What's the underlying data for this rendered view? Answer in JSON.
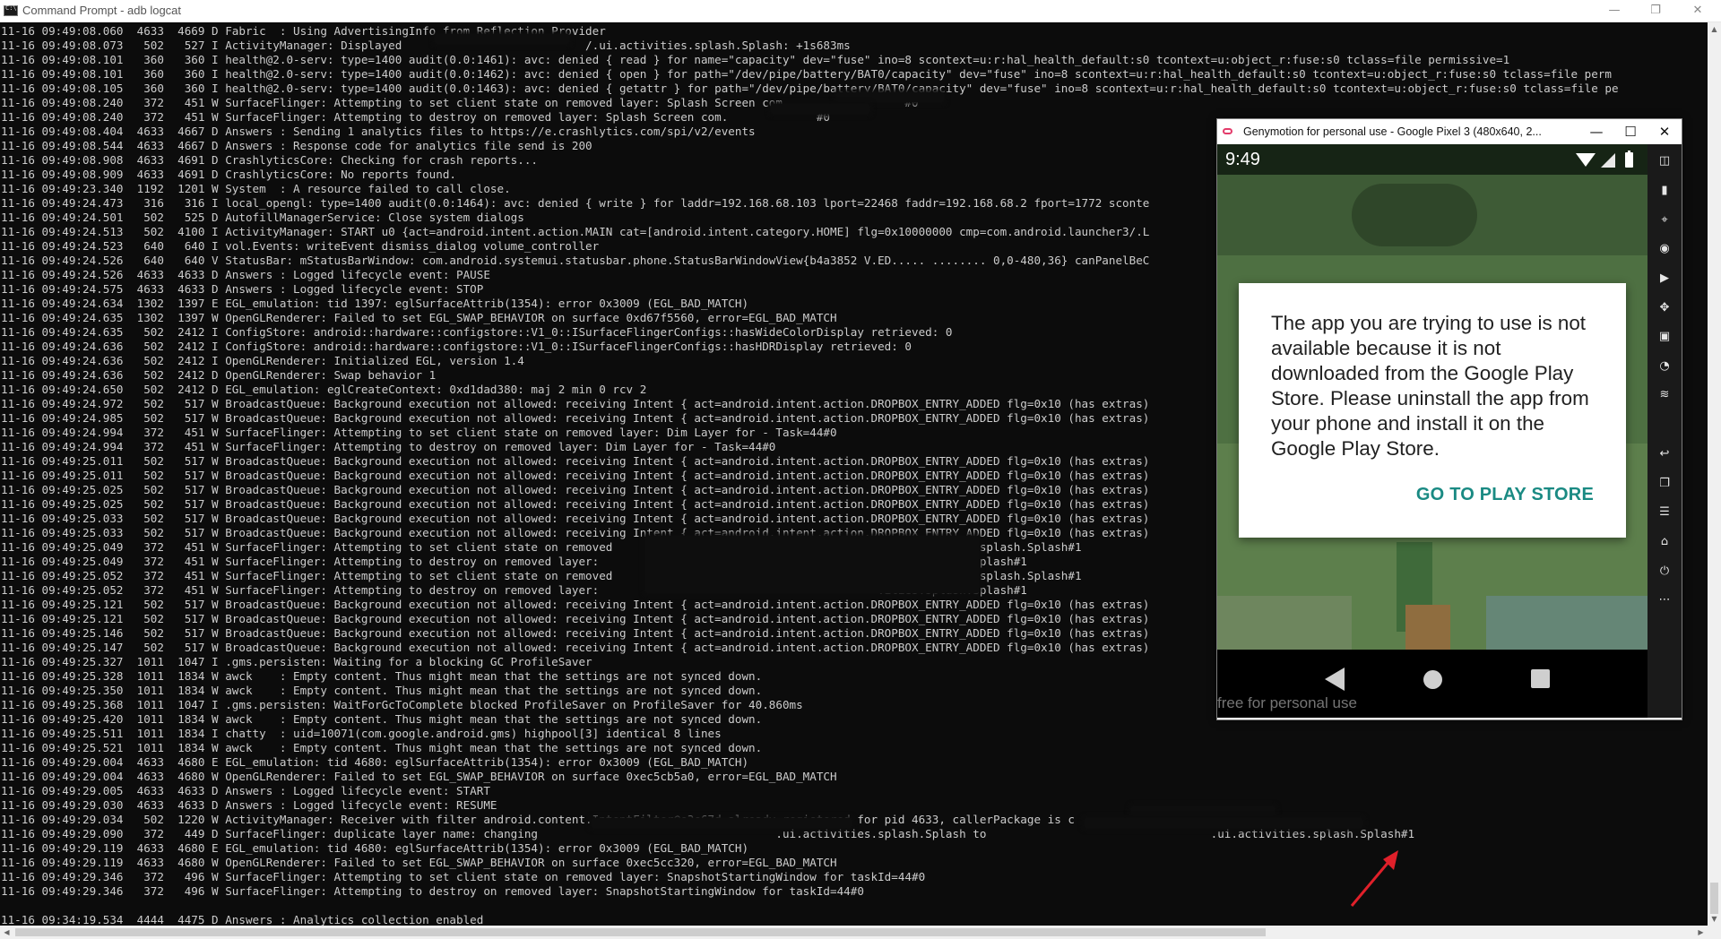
{
  "cmd": {
    "title": "Command Prompt - adb  logcat",
    "controls": {
      "minimize": "—",
      "maximize": "❐",
      "close": "✕"
    },
    "lines": [
      "11-16 09:49:08.060  4633  4669 D Fabric  : Using AdvertisingInfo from Reflection Provider",
      "11-16 09:49:08.073   502   527 I ActivityManager: Displayed                           /.ui.activities.splash.Splash: +1s683ms",
      "11-16 09:49:08.101   360   360 I health@2.0-serv: type=1400 audit(0.0:1461): avc: denied { read } for name=\"capacity\" dev=\"fuse\" ino=8 scontext=u:r:hal_health_default:s0 tcontext=u:object_r:fuse:s0 tclass=file permissive=1",
      "11-16 09:49:08.101   360   360 I health@2.0-serv: type=1400 audit(0.0:1462): avc: denied { open } for path=\"/dev/pipe/battery/BAT0/capacity\" dev=\"fuse\" ino=8 scontext=u:r:hal_health_default:s0 tcontext=u:object_r:fuse:s0 tclass=file perm",
      "11-16 09:49:08.105   360   360 I health@2.0-serv: type=1400 audit(0.0:1463): avc: denied { getattr } for path=\"/dev/pipe/battery/BAT0/capacity\" dev=\"fuse\" ino=8 scontext=u:r:hal_health_default:s0 tcontext=u:object_r:fuse:s0 tclass=file pe",
      "11-16 09:49:08.240   372   451 W SurfaceFlinger: Attempting to set client state on removed layer: Splash Screen com.                 #0",
      "11-16 09:49:08.240   372   451 W SurfaceFlinger: Attempting to destroy on removed layer: Splash Screen com.             #0",
      "11-16 09:49:08.404  4633  4667 D Answers : Sending 1 analytics files to https://e.crashlytics.com/spi/v2/events",
      "11-16 09:49:08.544  4633  4667 D Answers : Response code for analytics file send is 200",
      "11-16 09:49:08.908  4633  4691 D CrashlyticsCore: Checking for crash reports...",
      "11-16 09:49:08.909  4633  4691 D CrashlyticsCore: No reports found.",
      "11-16 09:49:23.340  1192  1201 W System  : A resource failed to call close.",
      "11-16 09:49:24.473   316   316 I local_opengl: type=1400 audit(0.0:1464): avc: denied { write } for laddr=192.168.68.103 lport=22468 faddr=192.168.68.2 fport=1772 sconte",
      "11-16 09:49:24.501   502   525 D AutofillManagerService: Close system dialogs",
      "11-16 09:49:24.513   502  4100 I ActivityManager: START u0 {act=android.intent.action.MAIN cat=[android.intent.category.HOME] flg=0x10000000 cmp=com.android.launcher3/.L",
      "11-16 09:49:24.523   640   640 I vol.Events: writeEvent dismiss_dialog volume_controller",
      "11-16 09:49:24.526   640   640 V StatusBar: mStatusBarWindow: com.android.systemui.statusbar.phone.StatusBarWindowView{b4a3852 V.ED..... ........ 0,0-480,36} canPanelBeC",
      "11-16 09:49:24.526  4633  4633 D Answers : Logged lifecycle event: PAUSE",
      "11-16 09:49:24.575  4633  4633 D Answers : Logged lifecycle event: STOP",
      "11-16 09:49:24.634  1302  1397 E EGL_emulation: tid 1397: eglSurfaceAttrib(1354): error 0x3009 (EGL_BAD_MATCH)",
      "11-16 09:49:24.635  1302  1397 W OpenGLRenderer: Failed to set EGL_SWAP_BEHAVIOR on surface 0xd67f5560, error=EGL_BAD_MATCH",
      "11-16 09:49:24.635   502  2412 I ConfigStore: android::hardware::configstore::V1_0::ISurfaceFlingerConfigs::hasWideColorDisplay retrieved: 0",
      "11-16 09:49:24.636   502  2412 I ConfigStore: android::hardware::configstore::V1_0::ISurfaceFlingerConfigs::hasHDRDisplay retrieved: 0",
      "11-16 09:49:24.636   502  2412 I OpenGLRenderer: Initialized EGL, version 1.4",
      "11-16 09:49:24.636   502  2412 D OpenGLRenderer: Swap behavior 1",
      "11-16 09:49:24.650   502  2412 D EGL_emulation: eglCreateContext: 0xd1dad380: maj 2 min 0 rcv 2",
      "11-16 09:49:24.972   502   517 W BroadcastQueue: Background execution not allowed: receiving Intent { act=android.intent.action.DROPBOX_ENTRY_ADDED flg=0x10 (has extras)",
      "11-16 09:49:24.985   502   517 W BroadcastQueue: Background execution not allowed: receiving Intent { act=android.intent.action.DROPBOX_ENTRY_ADDED flg=0x10 (has extras)",
      "11-16 09:49:24.994   372   451 W SurfaceFlinger: Attempting to set client state on removed layer: Dim Layer for - Task=44#0",
      "11-16 09:49:24.994   372   451 W SurfaceFlinger: Attempting to destroy on removed layer: Dim Layer for - Task=44#0",
      "11-16 09:49:25.011   502   517 W BroadcastQueue: Background execution not allowed: receiving Intent { act=android.intent.action.DROPBOX_ENTRY_ADDED flg=0x10 (has extras)",
      "11-16 09:49:25.011   502   517 W BroadcastQueue: Background execution not allowed: receiving Intent { act=android.intent.action.DROPBOX_ENTRY_ADDED flg=0x10 (has extras)",
      "11-16 09:49:25.025   502   517 W BroadcastQueue: Background execution not allowed: receiving Intent { act=android.intent.action.DROPBOX_ENTRY_ADDED flg=0x10 (has extras)",
      "11-16 09:49:25.025   502   517 W BroadcastQueue: Background execution not allowed: receiving Intent { act=android.intent.action.DROPBOX_ENTRY_ADDED flg=0x10 (has extras)",
      "11-16 09:49:25.033   502   517 W BroadcastQueue: Background execution not allowed: receiving Intent { act=android.intent.action.DROPBOX_ENTRY_ADDED flg=0x10 (has extras)",
      "11-16 09:49:25.033   502   517 W BroadcastQueue: Background execution not allowed: receiving Intent { act=android.intent.action.DROPBOX_ENTRY_ADDED flg=0x10 (has extras)",
      "11-16 09:49:25.049   372   451 W SurfaceFlinger: Attempting to set client state on removed                                       .ui.activities.splash.Splash#1",
      "11-16 09:49:25.049   372   451 W SurfaceFlinger: Attempting to destroy on removed layer:                                         vities.splash.Splash#1",
      "11-16 09:49:25.052   372   451 W SurfaceFlinger: Attempting to set client state on removed                                       .ui.activities.splash.Splash#1",
      "11-16 09:49:25.052   372   451 W SurfaceFlinger: Attempting to destroy on removed layer:                                         vities.splash.Splash#1",
      "11-16 09:49:25.121   502   517 W BroadcastQueue: Background execution not allowed: receiving Intent { act=android.intent.action.DROPBOX_ENTRY_ADDED flg=0x10 (has extras)",
      "11-16 09:49:25.121   502   517 W BroadcastQueue: Background execution not allowed: receiving Intent { act=android.intent.action.DROPBOX_ENTRY_ADDED flg=0x10 (has extras)",
      "11-16 09:49:25.146   502   517 W BroadcastQueue: Background execution not allowed: receiving Intent { act=android.intent.action.DROPBOX_ENTRY_ADDED flg=0x10 (has extras)",
      "11-16 09:49:25.147   502   517 W BroadcastQueue: Background execution not allowed: receiving Intent { act=android.intent.action.DROPBOX_ENTRY_ADDED flg=0x10 (has extras)",
      "11-16 09:49:25.327  1011  1047 I .gms.persisten: Waiting for a blocking GC ProfileSaver",
      "11-16 09:49:25.328  1011  1834 W awck    : Empty content. Thus might mean that the settings are not synced down.",
      "11-16 09:49:25.350  1011  1834 W awck    : Empty content. Thus might mean that the settings are not synced down.",
      "11-16 09:49:25.368  1011  1047 I .gms.persisten: WaitForGcToComplete blocked ProfileSaver on ProfileSaver for 40.860ms",
      "11-16 09:49:25.420  1011  1834 W awck    : Empty content. Thus might mean that the settings are not synced down.",
      "11-16 09:49:25.511  1011  1834 I chatty  : uid=10071(com.google.android.gms) highpool[3] identical 8 lines",
      "11-16 09:49:25.521  1011  1834 W awck    : Empty content. Thus might mean that the settings are not synced down.",
      "11-16 09:49:29.004  4633  4680 E EGL_emulation: tid 4680: eglSurfaceAttrib(1354): error 0x3009 (EGL_BAD_MATCH)",
      "11-16 09:49:29.004  4633  4680 W OpenGLRenderer: Failed to set EGL_SWAP_BEHAVIOR on surface 0xec5cb5a0, error=EGL_BAD_MATCH",
      "11-16 09:49:29.005  4633  4633 D Answers : Logged lifecycle event: START",
      "11-16 09:49:29.030  4633  4633 D Answers : Logged lifecycle event: RESUME",
      "11-16 09:49:29.034   502  1220 W ActivityManager: Receiver with filter android.content.IntentFilter@e3e67d already registered for pid 4633, callerPackage is c",
      "11-16 09:49:29.090   372   449 D SurfaceFlinger: duplicate layer name: changing                                   .ui.activities.splash.Splash to                                 .ui.activities.splash.Splash#1",
      "11-16 09:49:29.119  4633  4680 E EGL_emulation: tid 4680: eglSurfaceAttrib(1354): error 0x3009 (EGL_BAD_MATCH)",
      "11-16 09:49:29.119  4633  4680 W OpenGLRenderer: Failed to set EGL_SWAP_BEHAVIOR on surface 0xec5cc320, error=EGL_BAD_MATCH",
      "11-16 09:49:29.346   372   496 W SurfaceFlinger: Attempting to set client state on removed layer: SnapshotStartingWindow for taskId=44#0",
      "11-16 09:49:29.346   372   496 W SurfaceFlinger: Attempting to destroy on removed layer: SnapshotStartingWindow for taskId=44#0",
      "",
      "11-16 09:34:19.534  4444  4475 D Answers : Analytics collection enabled"
    ]
  },
  "genymotion": {
    "title": "Genymotion for personal use - Google Pixel 3 (480x640, 2...",
    "controls": {
      "minimize": "—",
      "maximize": "☐",
      "close": "✕"
    },
    "clock": "9:49",
    "dialog": {
      "message": "The app you are trying to use is not available because it is not downloaded from the Google Play Store. Please uninstall the app from your phone and install it on the Google Play Store.",
      "button": "GO TO PLAY STORE"
    },
    "watermark": "free for personal use",
    "toolbar": [
      {
        "name": "open-gapps-icon",
        "glyph": "◫"
      },
      {
        "name": "battery-widget-icon",
        "glyph": "▮"
      },
      {
        "name": "gps-widget-icon",
        "glyph": "⌖"
      },
      {
        "name": "camera-widget-icon",
        "glyph": "◉"
      },
      {
        "name": "capture-widget-icon",
        "glyph": "▶"
      },
      {
        "name": "dpad-widget-icon",
        "glyph": "✥"
      },
      {
        "name": "identifiers-widget-icon",
        "glyph": "▣"
      },
      {
        "name": "disk-io-widget-icon",
        "glyph": "◔"
      },
      {
        "name": "network-widget-icon",
        "glyph": "≋"
      },
      {
        "name": "back-button-icon",
        "glyph": "↩"
      },
      {
        "name": "recent-apps-button-icon",
        "glyph": "❐"
      },
      {
        "name": "menu-button-icon",
        "glyph": "☰"
      },
      {
        "name": "home-button-icon",
        "glyph": "⌂"
      },
      {
        "name": "power-button-icon",
        "glyph": "⏻"
      },
      {
        "name": "more-options-icon",
        "glyph": "⋯"
      }
    ]
  },
  "colors": {
    "console_bg": "#0c0c0c",
    "console_text": "#cccccc",
    "accent_button": "#1a8a83",
    "annotation_arrow": "#e0202a"
  }
}
